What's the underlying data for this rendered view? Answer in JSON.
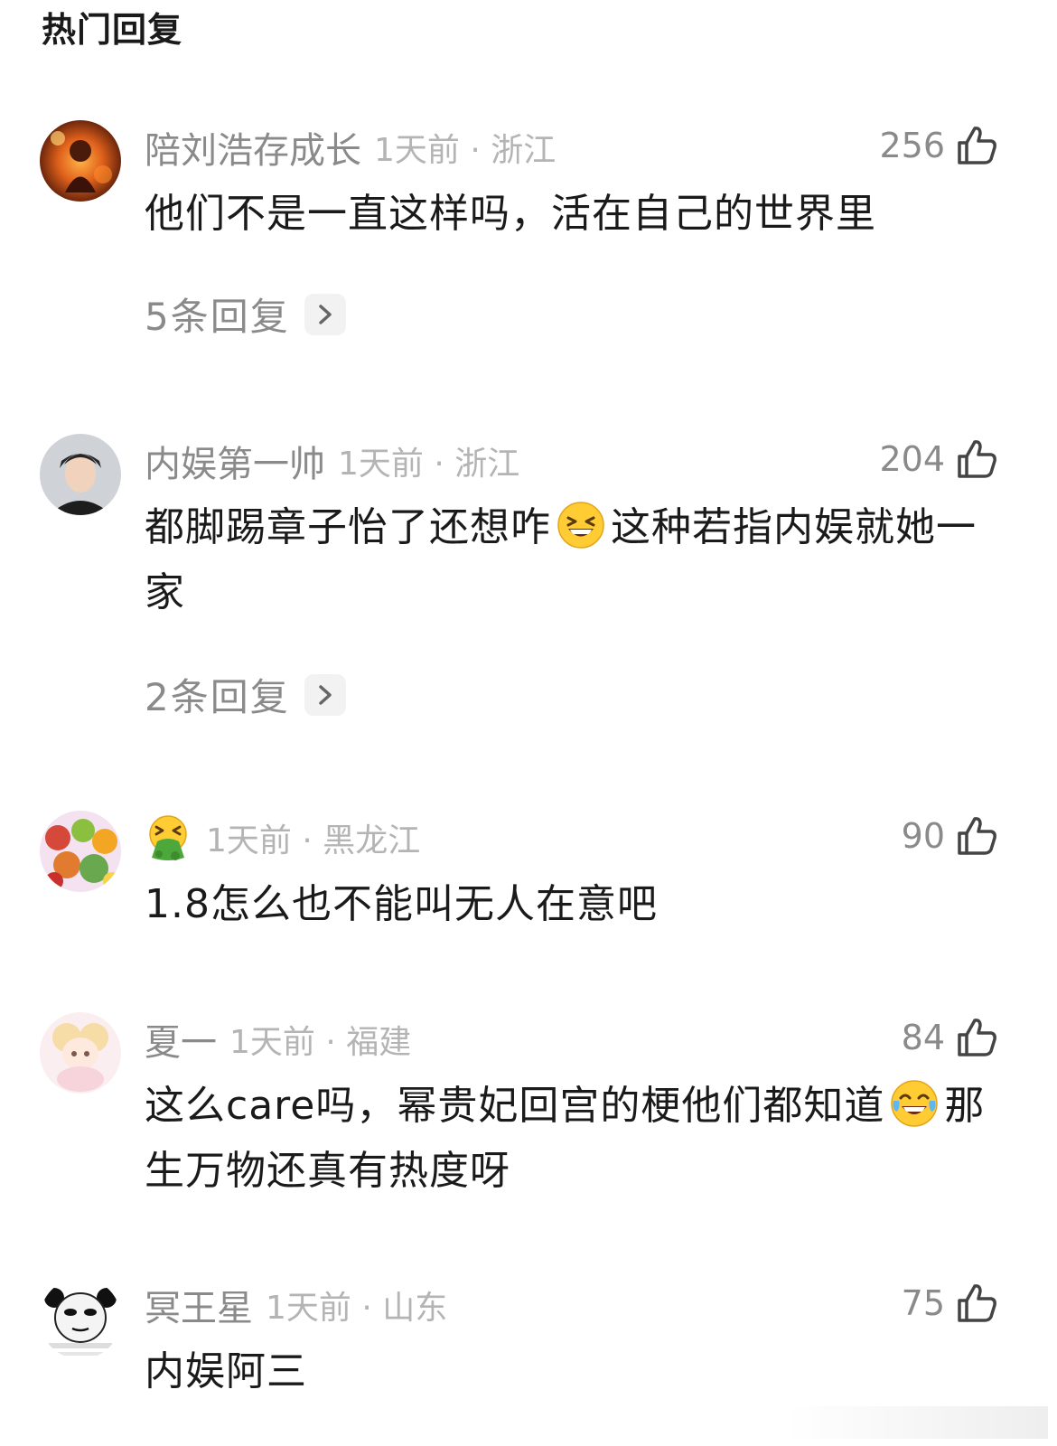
{
  "section_title": "热门回复",
  "comments": [
    {
      "username": "陪刘浩存成长",
      "time_location": "1天前 · 浙江",
      "likes": "256",
      "content_lines": [
        "他们不是一直这样吗，活在自己的世界里"
      ],
      "replies_label": "5条回复"
    },
    {
      "username": "内娱第一帅",
      "time_location": "1天前 · 浙江",
      "likes": "204",
      "content_before_emoji": "都脚踢章子怡了还想咋",
      "content_emoji": "grinning-squint-emoji",
      "content_after_emoji": "这种若指内娱就她一家",
      "replies_label": "2条回复"
    },
    {
      "username_icon": "vomiting-face-emoji",
      "time_location": "1天前 · 黑龙江",
      "likes": "90",
      "content_lines": [
        "1.8怎么也不能叫无人在意吧"
      ]
    },
    {
      "username": "夏一",
      "time_location": "1天前 · 福建",
      "likes": "84",
      "content_before_emoji": "这么care吗，幂贵妃回宫的梗他们都知道",
      "content_emoji": "tears-of-joy-emoji",
      "content_after_emoji": "那生万物还真有热度呀"
    },
    {
      "username": "冥王星",
      "time_location": "1天前 · 山东",
      "likes": "75",
      "content_lines": [
        "内娱阿三"
      ]
    }
  ],
  "colors": {
    "username": "#8a8a8a",
    "meta": "#b4b4b4",
    "text": "#1a1a1a",
    "chevron_bg": "#f2f2f2"
  }
}
